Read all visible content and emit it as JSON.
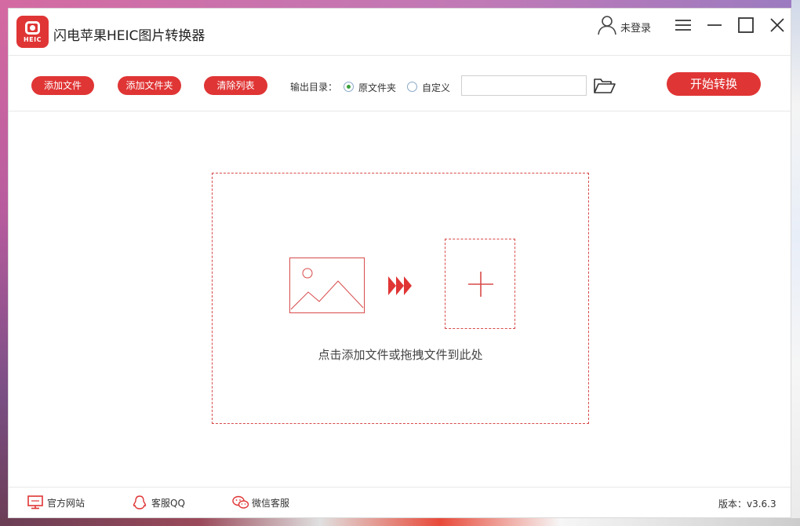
{
  "app": {
    "logo_text": "HEIC",
    "title": "闪电苹果HEIC图片转换器"
  },
  "header": {
    "user_label": "未登录"
  },
  "toolbar": {
    "add_file": "添加文件",
    "add_folder": "添加文件夹",
    "clear_list": "清除列表",
    "output_label": "输出目录：",
    "option_original": "原文件夹",
    "option_custom": "自定义",
    "selected_option": "原文件夹",
    "path_value": "",
    "start": "开始转换"
  },
  "main": {
    "drop_hint": "点击添加文件或拖拽文件到此处"
  },
  "footer": {
    "official_site": "官方网站",
    "support_qq": "客服QQ",
    "support_wechat": "微信客服",
    "version": "版本：v3.6.3"
  },
  "colors": {
    "accent": "#e03535",
    "radio_checked": "#3aa03a"
  },
  "icons": [
    "user-icon",
    "menu-icon",
    "minimize-icon",
    "maximize-icon",
    "close-icon",
    "folder-open-icon",
    "image-icon",
    "arrows-icon",
    "plus-icon",
    "monitor-icon",
    "qq-icon",
    "wechat-icon"
  ]
}
